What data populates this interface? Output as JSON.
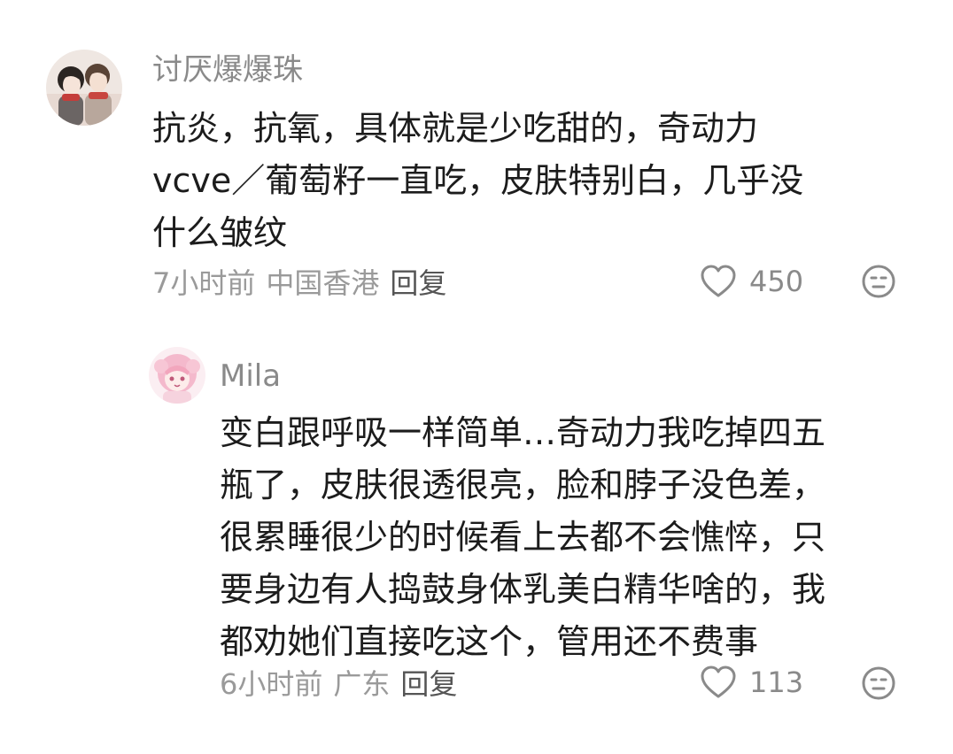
{
  "comments": [
    {
      "username": "讨厌爆爆珠",
      "avatar_icon": "anime-couple-avatar",
      "lines": [
        "抗炎，抗氧，具体就是少吃甜的，奇动力",
        "vcve／葡萄籽一直吃，皮肤特别白，几乎没",
        "什么皱纹"
      ],
      "time": "7小时前",
      "location": "中国香港",
      "reply_label": "回复",
      "likes": "450",
      "like_icon": "heart-outline-icon",
      "reaction_icon": "neutral-face-icon"
    },
    {
      "username": "Mila",
      "avatar_icon": "pink-anime-girl-avatar",
      "lines": [
        "变白跟呼吸一样简单…奇动力我吃掉四五",
        "瓶了，皮肤很透很亮，脸和脖子没色差，",
        "很累睡很少的时候看上去都不会憔悴，只",
        "要身边有人捣鼓身体乳美白精华啥的，我",
        "都劝她们直接吃这个，管用还不费事"
      ],
      "time": "6小时前",
      "location": "广东",
      "reply_label": "回复",
      "likes": "113",
      "like_icon": "heart-outline-icon",
      "reaction_icon": "neutral-face-icon"
    }
  ],
  "colors": {
    "username": "#8a8a8a",
    "body": "#1c1c1c",
    "meta": "#9a9a9a",
    "icon": "#8a8a8a"
  }
}
